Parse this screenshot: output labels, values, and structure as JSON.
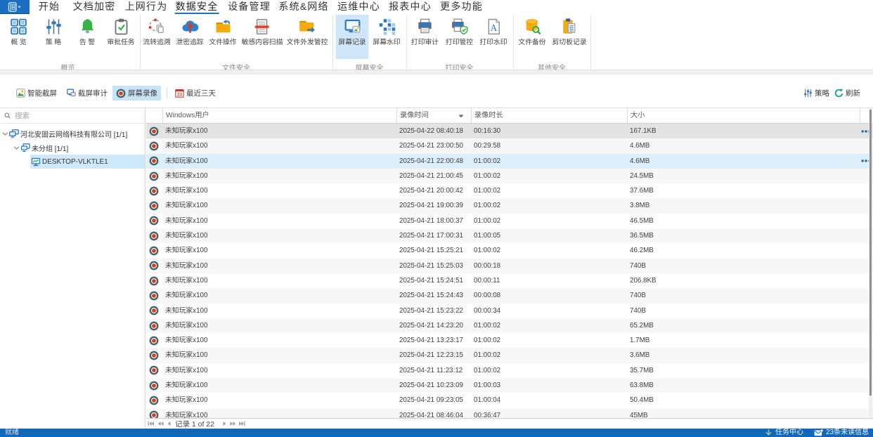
{
  "menubar": {
    "app_button_icon": "app-icon",
    "items": [
      {
        "label": "开始",
        "active": false
      },
      {
        "label": "文档加密",
        "active": false
      },
      {
        "label": "上网行为",
        "active": false
      },
      {
        "label": "数据安全",
        "active": true
      },
      {
        "label": "设备管理",
        "active": false
      },
      {
        "label": "系统&网络",
        "active": false
      },
      {
        "label": "运维中心",
        "active": false
      },
      {
        "label": "报表中心",
        "active": false
      },
      {
        "label": "更多功能",
        "active": false
      }
    ]
  },
  "ribbon": {
    "groups": [
      {
        "title": "概览",
        "items": [
          {
            "label": "概 览",
            "icon": "overview-icon",
            "selected": false
          },
          {
            "label": "策 略",
            "icon": "policy-icon",
            "selected": false
          },
          {
            "label": "告 警",
            "icon": "alert-icon",
            "selected": false
          },
          {
            "label": "审批任务",
            "icon": "approval-icon",
            "selected": false
          }
        ]
      },
      {
        "title": "文件安全",
        "items": [
          {
            "label": "流转追溯",
            "icon": "trace-icon",
            "selected": false
          },
          {
            "label": "泄密追踪",
            "icon": "leak-icon",
            "selected": false
          },
          {
            "label": "文件操作",
            "icon": "fileop-icon",
            "selected": false
          },
          {
            "label": "敏感内容扫描",
            "icon": "scan-icon",
            "selected": false
          },
          {
            "label": "文件外发管控",
            "icon": "outgoing-icon",
            "selected": false
          }
        ]
      },
      {
        "title": "屏幕安全",
        "items": [
          {
            "label": "屏幕记录",
            "icon": "screenrec-icon",
            "selected": true
          },
          {
            "label": "屏幕水印",
            "icon": "watermark-icon",
            "selected": false
          }
        ]
      },
      {
        "title": "打印安全",
        "items": [
          {
            "label": "打印审计",
            "icon": "printaudit-icon",
            "selected": false
          },
          {
            "label": "打印管控",
            "icon": "printctl-icon",
            "selected": false
          },
          {
            "label": "打印水印",
            "icon": "printwm-icon",
            "selected": false
          }
        ]
      },
      {
        "title": "其他安全",
        "items": [
          {
            "label": "文件备份",
            "icon": "backup-icon",
            "selected": false
          },
          {
            "label": "剪切板记录",
            "icon": "clipboard-icon",
            "selected": false
          }
        ]
      }
    ]
  },
  "toolbar": {
    "buttons": [
      {
        "label": "智能截屏",
        "icon": "smartshot-icon",
        "selected": false
      },
      {
        "label": "截屏审计",
        "icon": "capaudit-icon",
        "selected": false
      },
      {
        "label": "屏幕录像",
        "icon": "record-icon",
        "selected": true
      },
      {
        "label": "最近三天",
        "icon": "calendar-icon",
        "selected": false
      }
    ],
    "right_buttons": [
      {
        "label": "策略",
        "icon": "sliders-icon"
      },
      {
        "label": "刷新",
        "icon": "refresh-icon"
      }
    ]
  },
  "sidebar": {
    "search_placeholder": "搜索",
    "tree": [
      {
        "label": "河北安固云网络科技有限公司 [1/1]",
        "level": 0,
        "icon": "org-icon",
        "expanded": true,
        "selected": false
      },
      {
        "label": "未分组 [1/1]",
        "level": 1,
        "icon": "group-icon",
        "expanded": true,
        "selected": false
      },
      {
        "label": "DESKTOP-VLKTLE1",
        "level": 2,
        "icon": "pc-icon",
        "expanded": false,
        "selected": true
      }
    ]
  },
  "table": {
    "columns": [
      "Windows用户",
      "录像时间",
      "录像时长",
      "大小"
    ],
    "row_icon": "record-icon",
    "rows": [
      {
        "user": "未知玩家x100",
        "time": "2025-04-22 08:40:18",
        "duration": "00:16:30",
        "size": "167.1KB",
        "state": "selected",
        "menu": true
      },
      {
        "user": "未知玩家x100",
        "time": "2025-04-21 23:00:50",
        "duration": "00:29:58",
        "size": "4.6MB",
        "state": "",
        "menu": false
      },
      {
        "user": "未知玩家x100",
        "time": "2025-04-21 22:00:48",
        "duration": "01:00:02",
        "size": "4.6MB",
        "state": "hover",
        "menu": true
      },
      {
        "user": "未知玩家x100",
        "time": "2025-04-21 21:00:45",
        "duration": "01:00:02",
        "size": "24.5MB",
        "state": "",
        "menu": false
      },
      {
        "user": "未知玩家x100",
        "time": "2025-04-21 20:00:42",
        "duration": "01:00:02",
        "size": "37.6MB",
        "state": "",
        "menu": false
      },
      {
        "user": "未知玩家x100",
        "time": "2025-04-21 19:00:39",
        "duration": "01:00:02",
        "size": "3.8MB",
        "state": "",
        "menu": false
      },
      {
        "user": "未知玩家x100",
        "time": "2025-04-21 18:00:37",
        "duration": "01:00:02",
        "size": "46.5MB",
        "state": "",
        "menu": false
      },
      {
        "user": "未知玩家x100",
        "time": "2025-04-21 17:00:31",
        "duration": "01:00:05",
        "size": "36.5MB",
        "state": "",
        "menu": false
      },
      {
        "user": "未知玩家x100",
        "time": "2025-04-21 15:25:21",
        "duration": "01:00:02",
        "size": "46.2MB",
        "state": "",
        "menu": false
      },
      {
        "user": "未知玩家x100",
        "time": "2025-04-21 15:25:03",
        "duration": "00:00:18",
        "size": "740B",
        "state": "",
        "menu": false
      },
      {
        "user": "未知玩家x100",
        "time": "2025-04-21 15:24:51",
        "duration": "00:00:11",
        "size": "206.8KB",
        "state": "",
        "menu": false
      },
      {
        "user": "未知玩家x100",
        "time": "2025-04-21 15:24:43",
        "duration": "00:00:08",
        "size": "740B",
        "state": "",
        "menu": false
      },
      {
        "user": "未知玩家x100",
        "time": "2025-04-21 15:23:22",
        "duration": "00:00:34",
        "size": "740B",
        "state": "",
        "menu": false
      },
      {
        "user": "未知玩家x100",
        "time": "2025-04-21 14:23:20",
        "duration": "01:00:02",
        "size": "65.2MB",
        "state": "",
        "menu": false
      },
      {
        "user": "未知玩家x100",
        "time": "2025-04-21 13:23:17",
        "duration": "01:00:02",
        "size": "1.7MB",
        "state": "",
        "menu": false
      },
      {
        "user": "未知玩家x100",
        "time": "2025-04-21 12:23:15",
        "duration": "01:00:02",
        "size": "3.6MB",
        "state": "",
        "menu": false
      },
      {
        "user": "未知玩家x100",
        "time": "2025-04-21 11:23:12",
        "duration": "01:00:02",
        "size": "35.7MB",
        "state": "",
        "menu": false
      },
      {
        "user": "未知玩家x100",
        "time": "2025-04-21 10:23:09",
        "duration": "01:00:03",
        "size": "63.8MB",
        "state": "",
        "menu": false
      },
      {
        "user": "未知玩家x100",
        "time": "2025-04-21 09:23:05",
        "duration": "01:00:04",
        "size": "50.4MB",
        "state": "",
        "menu": false
      },
      {
        "user": "未知玩家x100",
        "time": "2025-04-21 08:46:04",
        "duration": "00:36:47",
        "size": "45MB",
        "state": "",
        "menu": false
      }
    ]
  },
  "pager": {
    "record_label": "记录 1 of 22"
  },
  "statusbar": {
    "ready_label": "就绪",
    "task_center_label": "任务中心",
    "unread_label": "23条未读信息"
  },
  "colors": {
    "accent_blue": "#1b6fc2",
    "status_bar_blue": "#1267b8",
    "selected_light_blue": "#cfe6f8",
    "tree_selected": "#cde9fb",
    "row_selected_gray": "#e3e3e3",
    "row_hover_blue": "#dceefa",
    "record_red": "#d8391f"
  }
}
